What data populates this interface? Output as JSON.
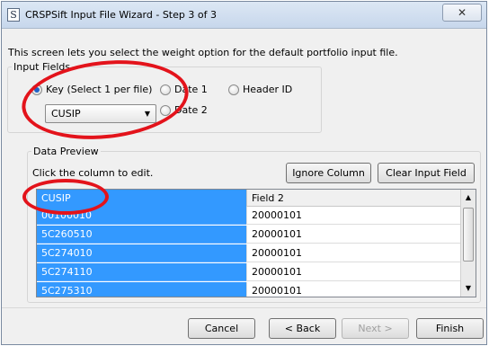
{
  "window": {
    "title": "CRSPSift Input File Wizard - Step 3 of 3",
    "icon": "app-icon",
    "close_label": "✕"
  },
  "intro": "This screen lets you select the weight option for the default portfolio input file.",
  "input_fields": {
    "legend": "Input Fields",
    "options": [
      {
        "label": "Key (Select 1 per file)",
        "selected": true
      },
      {
        "label": "Date 1",
        "selected": false
      },
      {
        "label": "Header ID",
        "selected": false
      },
      {
        "label": "Date 2",
        "selected": false
      }
    ],
    "key_select": {
      "value": "CUSIP"
    }
  },
  "data_preview": {
    "legend": "Data Preview",
    "hint": "Click the column to edit.",
    "buttons": {
      "ignore": "Ignore Column",
      "clear": "Clear Input Field"
    },
    "columns": [
      "CUSIP",
      "Field 2"
    ],
    "rows": [
      [
        "00100010",
        "20000101"
      ],
      [
        "5C260510",
        "20000101"
      ],
      [
        "5C274010",
        "20000101"
      ],
      [
        "5C274110",
        "20000101"
      ],
      [
        "5C275310",
        "20000101"
      ]
    ]
  },
  "footer": {
    "cancel": "Cancel",
    "back": "< Back",
    "next": "Next >",
    "finish": "Finish"
  },
  "colors": {
    "selection": "#3399ff",
    "annotation": "#e3131b",
    "title_bar": "#c7d7ec"
  }
}
